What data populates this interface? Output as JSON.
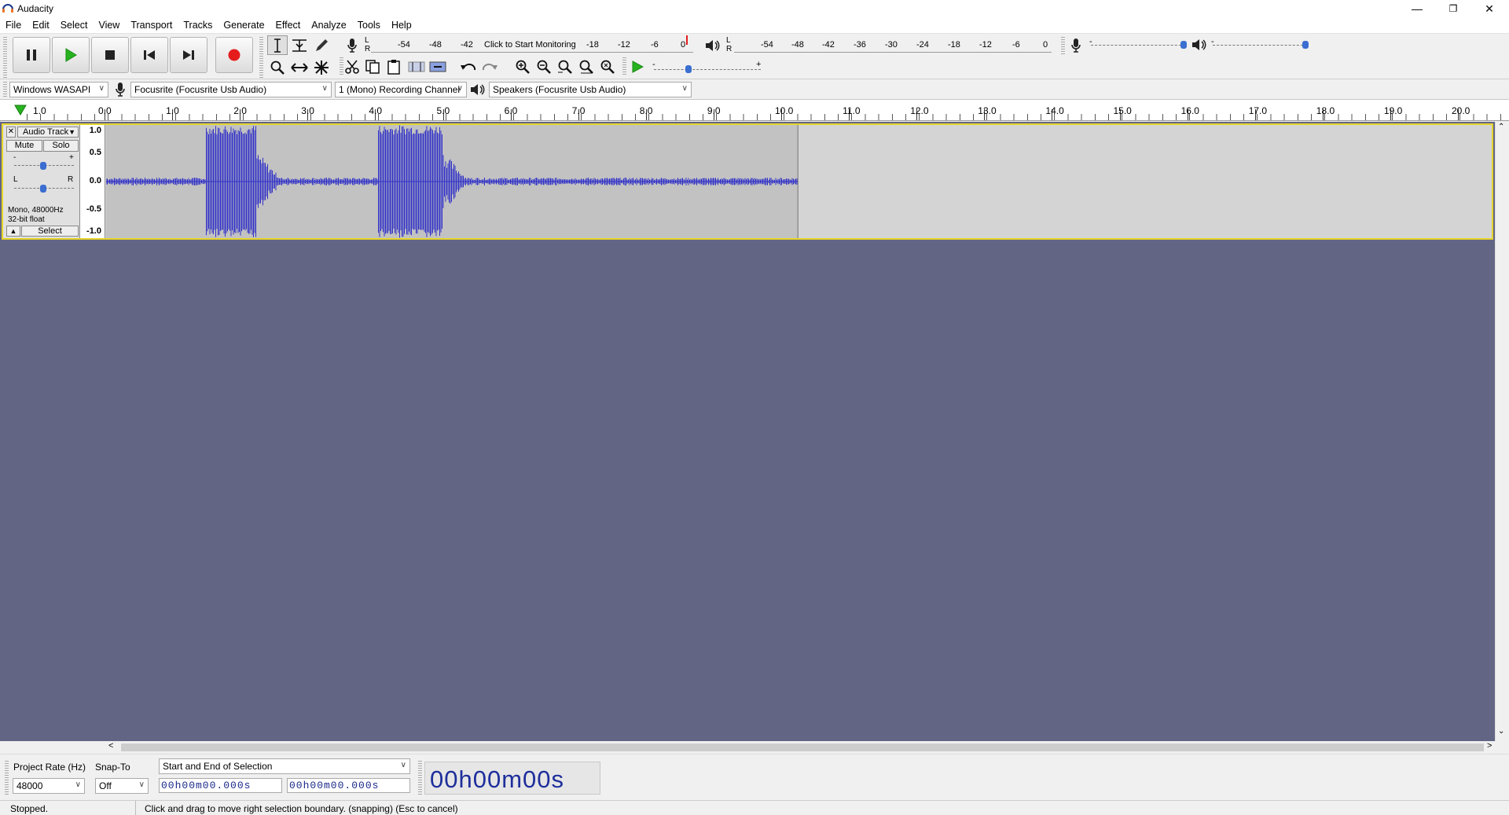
{
  "window": {
    "title": "Audacity",
    "minimize": "—",
    "restore": "❐",
    "close": "✕"
  },
  "menu": [
    "File",
    "Edit",
    "Select",
    "View",
    "Transport",
    "Tracks",
    "Generate",
    "Effect",
    "Analyze",
    "Tools",
    "Help"
  ],
  "meters": {
    "record_lr": [
      "L",
      "R"
    ],
    "record_scale": [
      "-54",
      "-48",
      "-42",
      "Click to Start Monitoring",
      "-18",
      "-12",
      "-6",
      "0"
    ],
    "play_lr": [
      "L",
      "R"
    ],
    "play_scale": [
      "-54",
      "-48",
      "-42",
      "-36",
      "-30",
      "-24",
      "-18",
      "-12",
      "-6",
      "0"
    ],
    "minus": "-",
    "plus": "+"
  },
  "device": {
    "host": "Windows WASAPI",
    "input": "Focusrite (Focusrite Usb Audio)",
    "channels": "1 (Mono) Recording Channel",
    "output": "Speakers (Focusrite Usb Audio)"
  },
  "ruler": {
    "start_label": "1.0",
    "ticks": [
      "0.0",
      "1.0",
      "2.0",
      "3.0",
      "4.0",
      "5.0",
      "6.0",
      "7.0",
      "8.0",
      "9.0",
      "10.0",
      "11.0",
      "12.0",
      "13.0",
      "14.0",
      "15.0",
      "16.0",
      "17.0",
      "18.0",
      "19.0",
      "20.0"
    ]
  },
  "track": {
    "name": "Audio Track",
    "close": "✕",
    "mute": "Mute",
    "solo": "Solo",
    "gain_minus": "-",
    "gain_plus": "+",
    "pan_left": "L",
    "pan_right": "R",
    "info_line1": "Mono, 48000Hz",
    "info_line2": "32-bit float",
    "select": "Select",
    "collapse": "▲",
    "vscale": [
      "1.0",
      "0.5",
      "0.0",
      "-0.5",
      "-1.0"
    ],
    "clip_end_seconds": 10.2,
    "bursts_seconds": [
      [
        1.45,
        2.2
      ],
      [
        4.0,
        4.95
      ]
    ]
  },
  "selection": {
    "project_rate_label": "Project Rate (Hz)",
    "project_rate": "48000",
    "snap_to_label": "Snap-To",
    "snap_to": "Off",
    "mode": "Start and End of Selection",
    "start_time": "00h00m00.000s",
    "end_time": "00h00m00.000s",
    "audio_position": "00h00m00s"
  },
  "status": {
    "state": "Stopped.",
    "message": "Click and drag to move right selection boundary. (snapping) (Esc to cancel)"
  },
  "colors": {
    "record_red": "#e41c1c",
    "play_green": "#27b31f",
    "waveform": "#3232c8",
    "track_bg": "#636585",
    "selected_border": "#e6d52a"
  }
}
